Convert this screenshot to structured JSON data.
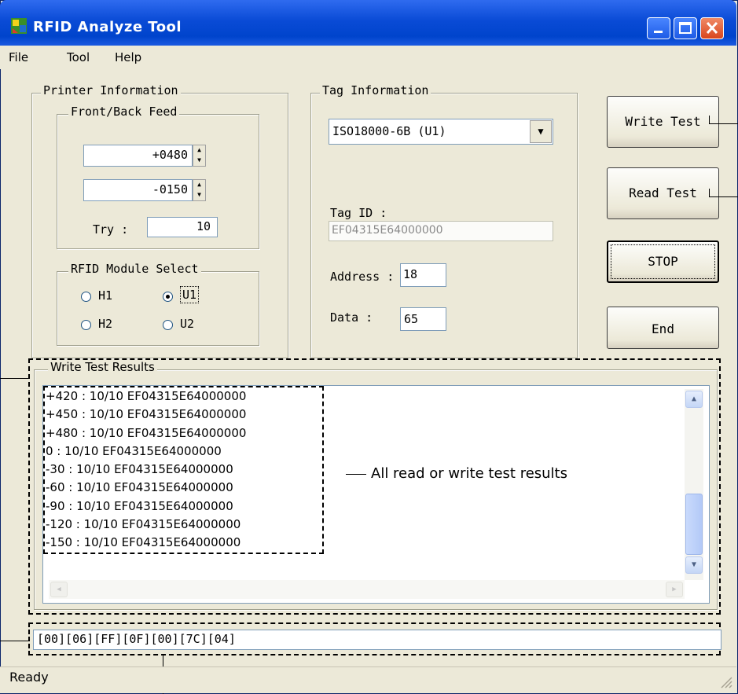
{
  "window": {
    "title": "RFID Analyze Tool"
  },
  "menu": {
    "items": [
      "File",
      "Tool",
      "Help"
    ]
  },
  "printer_info": {
    "group_label": "Printer Information",
    "feed_label": "Front/Back Feed",
    "front_feed": "+0480",
    "back_feed": "-0150",
    "try_label": "Try :",
    "try_value": "10"
  },
  "rfid_module": {
    "group_label": "RFID Module Select",
    "options": [
      "H1",
      "U1",
      "H2",
      "U2"
    ],
    "selected": "U1"
  },
  "tag_info": {
    "group_label": "Tag Information",
    "tag_type": "ISO18000-6B (U1)",
    "tag_id_label": "Tag ID :",
    "tag_id_value": "EF04315E64000000",
    "address_label": "Address :",
    "address_value": "18",
    "data_label": "Data :",
    "data_value": "65"
  },
  "buttons": {
    "write_test": "Write Test",
    "read_test": "Read Test",
    "stop": "STOP",
    "end": "End"
  },
  "results": {
    "group_label": "Write Test Results",
    "lines": [
      "+420 : 10/10 EF04315E64000000",
      "+450 : 10/10 EF04315E64000000",
      "+480 : 10/10 EF04315E64000000",
      "0 : 10/10 EF04315E64000000",
      "-30 : 10/10 EF04315E64000000",
      "-60 : 10/10 EF04315E64000000",
      "-90 : 10/10 EF04315E64000000",
      "-120 : 10/10 EF04315E64000000",
      "-150 : 10/10 EF04315E64000000"
    ],
    "annotation": "All read or write test results"
  },
  "command": {
    "value": "[00][06][FF][0F][00][7C][04]"
  },
  "status": {
    "text": "Ready"
  },
  "colors": {
    "title_bar": "#0a4bd6",
    "window_bg": "#ece9d8",
    "close_button": "#d9461d"
  }
}
